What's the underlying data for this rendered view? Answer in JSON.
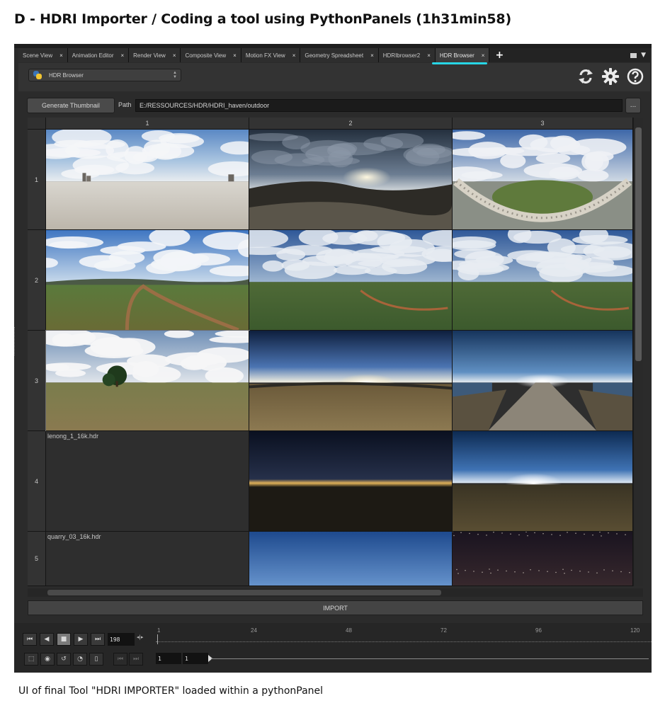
{
  "page": {
    "heading": "D - HDRI Importer / Coding a tool using PythonPanels (1h31min58)",
    "caption": "UI of final Tool \"HDRI IMPORTER\" loaded within a pythonPanel"
  },
  "colors": {
    "accent_underline": "#27d6e6",
    "window_bg": "#2b2b2b",
    "toolbar_bg": "#333333"
  },
  "tabs": [
    {
      "label": "Scene View",
      "active": false
    },
    {
      "label": "Animation Editor",
      "active": false
    },
    {
      "label": "Render View",
      "active": false
    },
    {
      "label": "Composite View",
      "active": false
    },
    {
      "label": "Motion FX View",
      "active": false
    },
    {
      "label": "Geometry Spreadsheet",
      "active": false
    },
    {
      "label": "HDRIbrowser2",
      "active": false
    },
    {
      "label": "HDR Browser",
      "active": true
    }
  ],
  "tab_close_glyph": "×",
  "tab_add_glyph": "+",
  "toolbar": {
    "panel_selector": "HDR Browser",
    "icons": [
      "refresh-icon",
      "gear-icon",
      "help-icon"
    ]
  },
  "browser": {
    "generate_label": "Generate Thumbnail",
    "path_label": "Path",
    "path_value": "E:/RESSOURCES/HDR/HDRI_haven/outdoor",
    "browse_label": "...",
    "import_label": "IMPORT"
  },
  "grid": {
    "columns": [
      "1",
      "2",
      "3"
    ],
    "rows": [
      {
        "label": "1",
        "cells": [
          {
            "scene": "beach",
            "caption": ""
          },
          {
            "scene": "rocky-sunset",
            "caption": ""
          },
          {
            "scene": "bridge",
            "caption": ""
          }
        ]
      },
      {
        "label": "2",
        "cells": [
          {
            "scene": "meadow-path",
            "caption": ""
          },
          {
            "scene": "field-cloudy",
            "caption": ""
          },
          {
            "scene": "field-cloudy",
            "caption": ""
          }
        ]
      },
      {
        "label": "3",
        "cells": [
          {
            "scene": "tree-field",
            "caption": ""
          },
          {
            "scene": "sunrise-ground",
            "caption": ""
          },
          {
            "scene": "road-water",
            "caption": ""
          }
        ]
      },
      {
        "label": "4",
        "cells": [
          {
            "scene": "empty",
            "caption": "lenong_1_16k.hdr"
          },
          {
            "scene": "night-lights",
            "caption": ""
          },
          {
            "scene": "dusk-hills",
            "caption": ""
          }
        ]
      },
      {
        "label": "5",
        "cells": [
          {
            "scene": "empty",
            "caption": "quarry_03_16k.hdr"
          },
          {
            "scene": "blue-sky-trees",
            "caption": ""
          },
          {
            "scene": "starry-night",
            "caption": ""
          }
        ]
      }
    ]
  },
  "timeline": {
    "current_frame": "198",
    "range_start": "1",
    "range_end": "1",
    "ruler_ticks": [
      "1",
      "24",
      "48",
      "72",
      "96",
      "120"
    ],
    "play_controls": [
      "skip-start-icon",
      "play-reverse-icon",
      "stop-icon",
      "play-forward-icon",
      "skip-end-icon"
    ],
    "step_glyphs": "◂|▸",
    "bottom_tools": [
      "select-icon",
      "audio-icon",
      "loop-icon",
      "realtime-icon",
      "keys-icon"
    ]
  }
}
